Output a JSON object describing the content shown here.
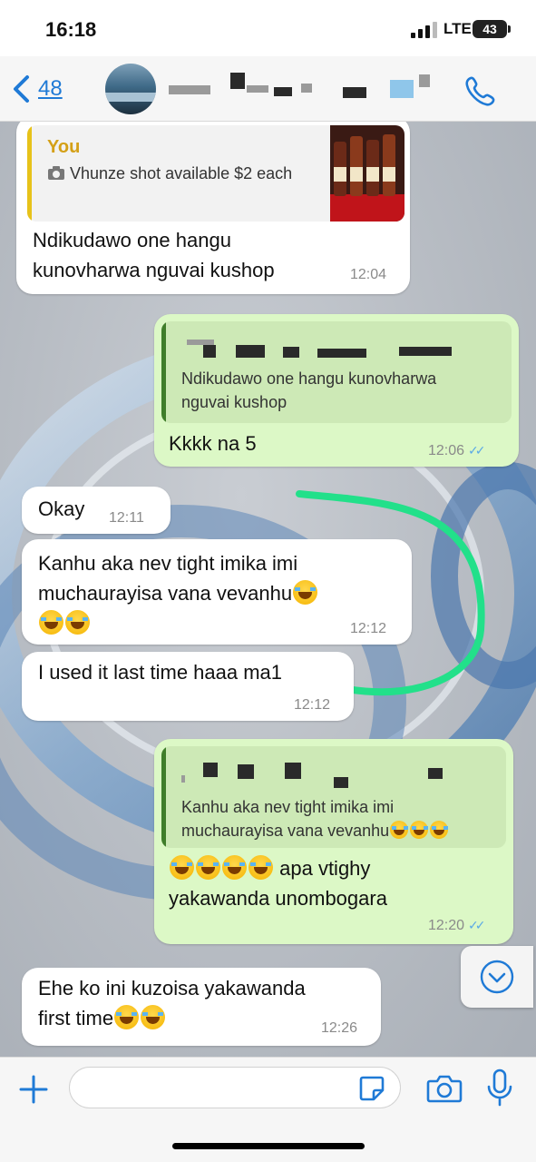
{
  "status_bar": {
    "time": "16:18",
    "network": "LTE",
    "battery": "43"
  },
  "header": {
    "back_count": "48",
    "back_icon": "chevron-left-icon",
    "call_icon": "phone-icon"
  },
  "messages": [
    {
      "direction": "incoming",
      "quote_author": "You",
      "quote_text": "Vhunze shot available $2 each",
      "quote_icon": "camera-icon",
      "text": "Ndikudawo one hangu kunovharwa nguvai kushop",
      "time": "12:04"
    },
    {
      "direction": "outgoing",
      "quote_text": "Ndikudawo one hangu kunovharwa nguvai kushop",
      "text": "Kkkk na 5",
      "time": "12:06",
      "status": "read"
    },
    {
      "direction": "incoming",
      "text": "Okay",
      "time": "12:11"
    },
    {
      "direction": "incoming",
      "text_line1": "Kanhu aka nev tight imika imi",
      "text_line2": "muchaurayisa vana vevanhu",
      "time": "12:12"
    },
    {
      "direction": "incoming",
      "text": "I used it last time haaa ma1",
      "time": "12:12"
    },
    {
      "direction": "outgoing",
      "quote_line1": "Kanhu aka nev tight imika imi",
      "quote_line2": "muchaurayisa vana vevanhu",
      "text_line1": "apa vtighy",
      "text_line2": "yakawanda unombogara",
      "time": "12:20",
      "status": "read"
    },
    {
      "direction": "incoming",
      "text_line1": "Ehe ko ini kuzoisa yakawanda",
      "text_line2": "first time",
      "time": "12:26"
    }
  ],
  "composer": {
    "placeholder": "",
    "icons": [
      "plus-icon",
      "sticker-icon",
      "camera-icon",
      "microphone-icon"
    ]
  },
  "colors": {
    "incoming_bubble": "#ffffff",
    "outgoing_bubble": "#dcf8c6",
    "accent": "#1f7ad6",
    "quote_author": "#d4a017",
    "annotation_stroke": "#22e08a"
  }
}
